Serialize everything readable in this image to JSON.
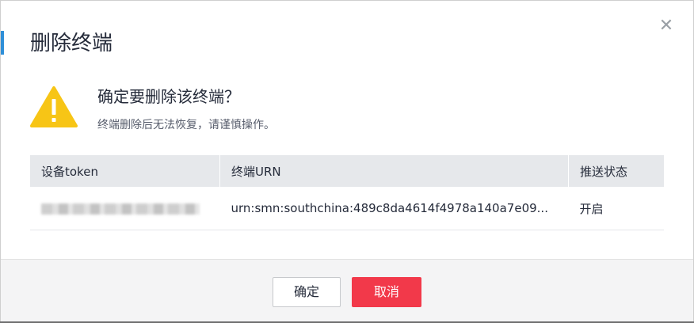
{
  "dialog": {
    "title": "删除终端",
    "close_icon": "close-icon",
    "message_title": "确定要删除该终端？",
    "message_sub": "终端删除后无法恢复，请谨慎操作。",
    "warning_icon": "warning-icon"
  },
  "table": {
    "headers": [
      "设备token",
      "终端URN",
      "推送状态"
    ],
    "rows": [
      {
        "token": "",
        "urn": "urn:smn:southchina:489c8da4614f4978a140a7e09...",
        "status": "开启"
      }
    ]
  },
  "footer": {
    "ok_label": "确定",
    "cancel_label": "取消"
  },
  "colors": {
    "accent": "#2f8fd8",
    "danger": "#f2394a",
    "warning": "#f7c516"
  }
}
